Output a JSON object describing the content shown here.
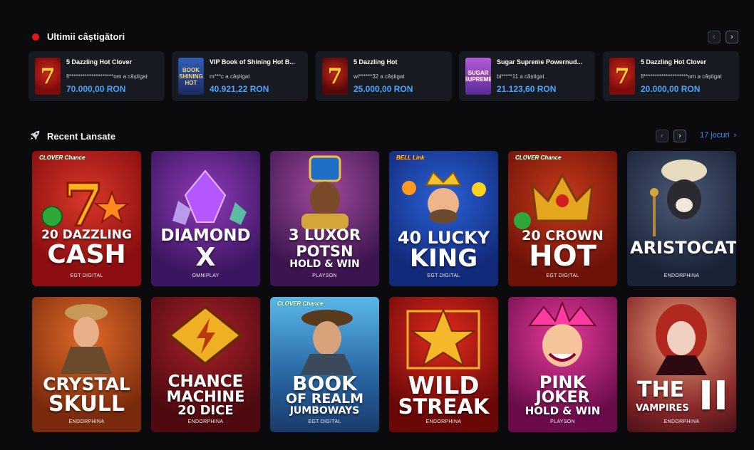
{
  "winners": {
    "title": "Ultimii câștigători",
    "prev_icon": "chevron-left-icon",
    "next_icon": "chevron-right-icon",
    "items": [
      {
        "game": "5 Dazzling Hot Clover",
        "user": "fl********************om a câștigat",
        "amount": "70.000,00 RON",
        "thumb_text": "7"
      },
      {
        "game": "VIP Book of Shining Hot B...",
        "user": "m***c a câștigat",
        "amount": "40.921,22 RON",
        "thumb_text": "BOOK SHINING HOT"
      },
      {
        "game": "5 Dazzling Hot",
        "user": "wi******32 a câștigat",
        "amount": "25.000,00 RON",
        "thumb_text": "7"
      },
      {
        "game": "Sugar Supreme Powernud...",
        "user": "bi*****11 a câștigat",
        "amount": "21.123,60 RON",
        "thumb_text": "SUGAR SUPREME"
      },
      {
        "game": "5 Dazzling Hot Clover",
        "user": "fl********************om a câștigat",
        "amount": "20.000,00 RON",
        "thumb_text": "7"
      }
    ]
  },
  "recent": {
    "title": "Recent Lansate",
    "count_label": "17 jocuri",
    "count_icon": "chevron-right-icon",
    "games": [
      {
        "line1": "20 DAZZLING",
        "line2": "CASH",
        "line3": "",
        "provider": "EGT DIGITAL",
        "badge": "CLOVER Chance"
      },
      {
        "line1": "DIAMOND",
        "line2": "X",
        "line3": "",
        "provider": "OMNIPLAY",
        "badge": ""
      },
      {
        "line1": "3 LUXOR",
        "line2": "POTSN",
        "line3": "HOLD & WIN",
        "provider": "PLAYSON",
        "badge": ""
      },
      {
        "line1": "40 LUCKY",
        "line2": "KING",
        "line3": "",
        "provider": "EGT DIGITAL",
        "badge": "BELL Link"
      },
      {
        "line1": "20 CROWN",
        "line2": "HOT",
        "line3": "",
        "provider": "EGT DIGITAL",
        "badge": "CLOVER Chance"
      },
      {
        "line1": "ARISTOCATS",
        "line2": "",
        "line3": "",
        "provider": "ENDORPHINA",
        "badge": ""
      },
      {
        "line1": "CRYSTAL",
        "line2": "SKULL",
        "line3": "",
        "provider": "ENDORPHINA",
        "badge": ""
      },
      {
        "line1": "CHANCE",
        "line2": "MACHINE",
        "line3": "20 DICE",
        "provider": "ENDORPHINA",
        "badge": ""
      },
      {
        "line1": "BOOK",
        "line2": "OF REALM",
        "line3": "JUMBOWAYS",
        "provider": "EGT DIGITAL",
        "badge": "CLOVER Chance"
      },
      {
        "line1": "WILD",
        "line2": "STREAK",
        "line3": "",
        "provider": "ENDORPHINA",
        "badge": ""
      },
      {
        "line1": "PINK",
        "line2": "JOKER",
        "line3": "HOLD & WIN",
        "provider": "PLAYSON",
        "badge": ""
      },
      {
        "line1": "THE",
        "line2": "VAMPIRES",
        "line3": "II",
        "provider": "ENDORPHINA",
        "badge": ""
      }
    ]
  }
}
